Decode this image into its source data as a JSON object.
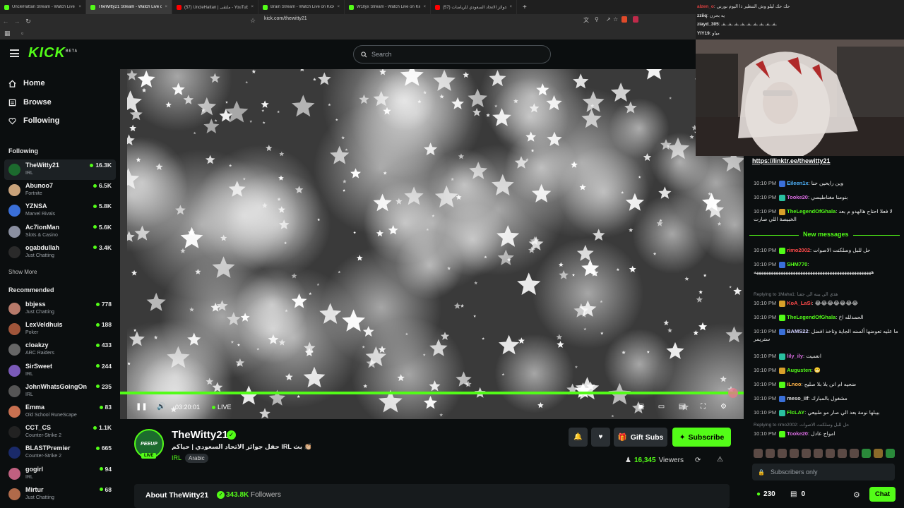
{
  "colors": {
    "accent": "#53fc18",
    "background": "#0b0e0f",
    "panel": "#171b1d",
    "muted": "#9aa0a6"
  },
  "browser": {
    "tabs": [
      {
        "label": "UncleHattan Stream - Watch Live on",
        "active": false,
        "favicon_color": "#53fc18"
      },
      {
        "label": "TheWitty21 Stream - Watch Live on",
        "active": true,
        "favicon_color": "#53fc18"
      },
      {
        "label": "(57) UncleHattan | ملتقى - YouTube",
        "active": false,
        "favicon_color": "#ff0000"
      },
      {
        "label": "Brain Stream - Watch Live on Kick",
        "active": false,
        "favicon_color": "#53fc18"
      },
      {
        "label": "W1llyx Stream - Watch Live on Kick",
        "active": false,
        "favicon_color": "#53fc18"
      },
      {
        "label": "(57) حفل جوائز الاتحاد السعودي للرياضات",
        "active": false,
        "favicon_color": "#ff0000"
      }
    ],
    "url": "kick.com/thewitty21",
    "bookmarks_label": "All Bookmarks"
  },
  "header": {
    "logo": "KICK",
    "logo_sup": "BETA",
    "search_placeholder": "Search"
  },
  "sidebar": {
    "nav": [
      {
        "label": "Home",
        "icon": "home-icon"
      },
      {
        "label": "Browse",
        "icon": "browse-icon"
      },
      {
        "label": "Following",
        "icon": "heart-icon"
      }
    ],
    "following_heading": "Following",
    "following": [
      {
        "name": "TheWitty21",
        "category": "IRL",
        "viewers": "16.3K",
        "selected": true,
        "avatar_color": "#1c6b2e"
      },
      {
        "name": "Abunoo7",
        "category": "Fortnite",
        "viewers": "6.5K",
        "selected": false,
        "avatar_color": "#c8a27a"
      },
      {
        "name": "YZNSA",
        "category": "Marvel Rivals",
        "viewers": "5.8K",
        "selected": false,
        "avatar_color": "#3a6fd8"
      },
      {
        "name": "Ac7ionMan",
        "category": "Slots & Casino",
        "viewers": "5.6K",
        "selected": false,
        "avatar_color": "#8a8fa0"
      },
      {
        "name": "ogabdullah",
        "category": "Just Chatting",
        "viewers": "3.4K",
        "selected": false,
        "avatar_color": "#2a2a2a"
      }
    ],
    "show_more": "Show More",
    "recommended_heading": "Recommended",
    "recommended": [
      {
        "name": "bbjess",
        "category": "Just Chatting",
        "viewers": "778",
        "avatar_color": "#b77a6a"
      },
      {
        "name": "LexVeldhuis",
        "category": "Poker",
        "viewers": "188",
        "avatar_color": "#a0553a"
      },
      {
        "name": "cloakzy",
        "category": "ARC Raiders",
        "viewers": "433",
        "avatar_color": "#666"
      },
      {
        "name": "SirSweet",
        "category": "IRL",
        "viewers": "244",
        "avatar_color": "#7a5ab8"
      },
      {
        "name": "JohnWhatsGoingOn",
        "category": "IRL",
        "viewers": "235",
        "avatar_color": "#555"
      },
      {
        "name": "Emma",
        "category": "Old School RuneScape",
        "viewers": "83",
        "avatar_color": "#c87050"
      },
      {
        "name": "CCT_CS",
        "category": "Counter-Strike 2",
        "viewers": "1.1K",
        "avatar_color": "#222"
      },
      {
        "name": "BLASTPremier",
        "category": "Counter-Strike 2",
        "viewers": "665",
        "avatar_color": "#1a2a6a"
      },
      {
        "name": "gogirl",
        "category": "IRL",
        "viewers": "94",
        "avatar_color": "#c06080"
      },
      {
        "name": "Mirtur",
        "category": "Just Chatting",
        "viewers": "68",
        "avatar_color": "#b06a4a"
      }
    ]
  },
  "player": {
    "time": "03:20:01",
    "live_label": "LIVE"
  },
  "stream": {
    "channel": "TheWitty21",
    "avatar_text": "PEEUP",
    "live_badge": "LIVE",
    "title": "حفل جوائز الاتحاد السعودي | حياكم IRL بث 👏🏼",
    "category": "IRL",
    "tag": "Arabic",
    "gift_label": "Gift Subs",
    "subscribe_label": "Subscribe",
    "viewers": "16,345",
    "viewers_label": "Viewers",
    "about_title": "About TheWitty21",
    "followers": "343.8K",
    "followers_label": "Followers"
  },
  "webcam_overlay": {
    "lines": [
      {
        "user": "alzen_o",
        "text": "حك حك ليلو وش التنظير ذا اليوم نورني",
        "color": "#e04040"
      },
      {
        "user": "zziiq",
        "text": "يه بحرن",
        "color": "#e0e0e0"
      },
      {
        "user": "ziayd_305",
        "text": "ـفـ ـفـ ـفـ ـفـ ـفـ ـفـ ـفـ ـفـ ـفـ",
        "color": "#e0e0e0"
      },
      {
        "user": "YIY19",
        "text": "مياو",
        "color": "#e0e0e0"
      }
    ]
  },
  "chat": {
    "pinned_link": "https://linktr.ee/thewitty21",
    "new_messages_label": "New messages",
    "messages": [
      {
        "time": "10:10 PM",
        "user": "Eileen1x",
        "color": "#4fb4ff",
        "text": "وين رايحين حنا"
      },
      {
        "time": "10:10 PM",
        "user": "Tooke20",
        "color": "#d86ce0",
        "text": "بنومنا مغناطيسي"
      },
      {
        "time": "10:10 PM",
        "user": "TheLegendOfGhala",
        "color": "#53fc18",
        "text": "لا فعلا احتاج هالهدو م بعد الخبيصة اللي صارت"
      },
      {
        "time": "10:10 PM",
        "user": "rimo2002",
        "color": "#ff4a4a",
        "text": "حل للبل وسلكنت الاصوات"
      },
      {
        "time": "10:10 PM",
        "user": "SHM770",
        "color": "#53fc18",
        "text": "ههههههههههههههههههههههههههههههههههههههههههههههههه"
      },
      {
        "reply": "Replying to 1Maha1: هذي الي يبنه الي جفنا"
      },
      {
        "time": "10:10 PM",
        "user": "KoA_LaSi",
        "color": "#ff4a4a",
        "text": "😂😂😂😂😂😂😂"
      },
      {
        "time": "10:10 PM",
        "user": "TheLegendOfGhala",
        "color": "#53fc18",
        "text": "الحمدلله اخ"
      },
      {
        "time": "10:10 PM",
        "user": "BAMS22",
        "color": "#d0d0ff",
        "text": "ما عليه تعوضها ألسنه الجاية وتاخذ افضل ستريمر"
      },
      {
        "time": "10:10 PM",
        "user": "lily_ily",
        "color": "#d86ce0",
        "text": "انعميت"
      },
      {
        "time": "10:10 PM",
        "user": "Augusten",
        "color": "#53fc18",
        "text": "😬"
      },
      {
        "time": "10:10 PM",
        "user": "iLnoo",
        "color": "#ffb347",
        "text": "ضحيه ام انن بلا بلا صليح"
      },
      {
        "time": "10:10 PM",
        "user": "meso_iif",
        "color": "#e0e0e0",
        "text": "مشغول بالمبارك"
      },
      {
        "time": "10:10 PM",
        "user": "FlcLAY",
        "color": "#53fc18",
        "text": "بيبلها نومة بعد الي صار مو طبيعي"
      },
      {
        "reply": "Replying to rimo2002: حل للبل وسلكنت الاصوات"
      },
      {
        "time": "10:10 PM",
        "user": "Tooke20",
        "color": "#d86ce0",
        "text": "امواج عادل"
      }
    ],
    "input_placeholder": "Subscribers only",
    "points": "230",
    "drops": "0",
    "chat_button": "Chat"
  }
}
